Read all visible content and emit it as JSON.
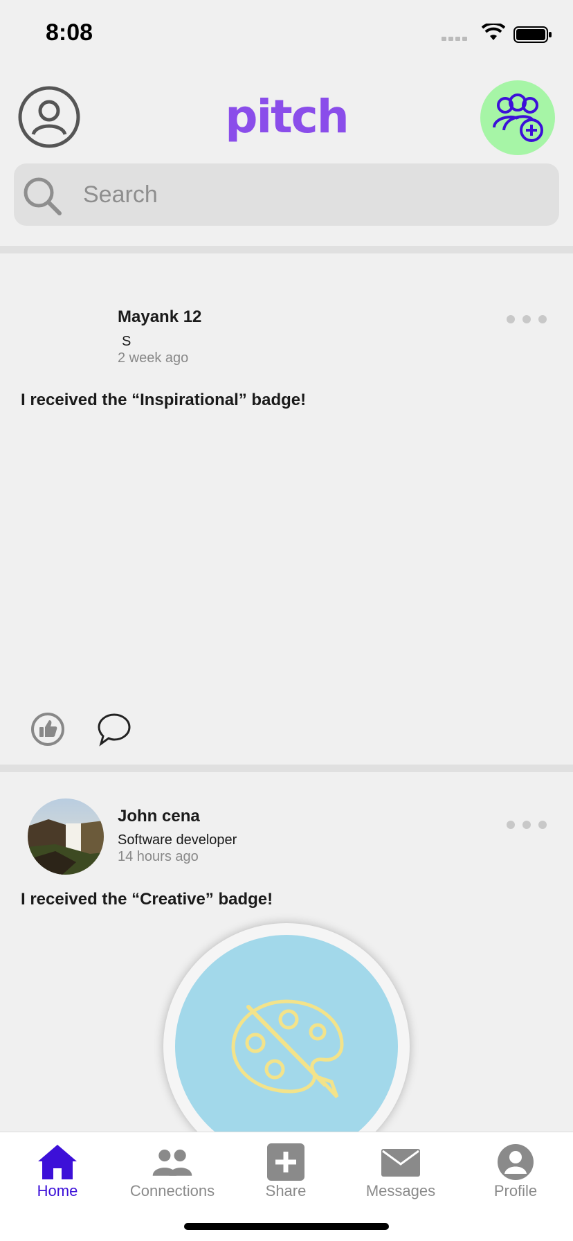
{
  "status_bar": {
    "time": "8:08"
  },
  "header": {
    "logo": "pitch"
  },
  "search": {
    "placeholder": "Search"
  },
  "posts": [
    {
      "author": "Mayank 12",
      "subtitle": "S",
      "time": "2 week ago",
      "text": "I received the “Inspirational” badge!"
    },
    {
      "author": "John cena",
      "subtitle": "Software developer",
      "time": "14 hours ago",
      "text": "I received the “Creative” badge!"
    }
  ],
  "tabs": [
    {
      "label": "Home",
      "icon": "home-icon",
      "active": true
    },
    {
      "label": "Connections",
      "icon": "connections-icon",
      "active": false
    },
    {
      "label": "Share",
      "icon": "share-icon",
      "active": false
    },
    {
      "label": "Messages",
      "icon": "messages-icon",
      "active": false
    },
    {
      "label": "Profile",
      "icon": "profile-icon",
      "active": false
    }
  ],
  "colors": {
    "brand": "#8a4dea",
    "active_tab": "#3c10d8",
    "add_connection_bg": "#a6f5a6",
    "badge_bg": "#a2d8ea"
  }
}
